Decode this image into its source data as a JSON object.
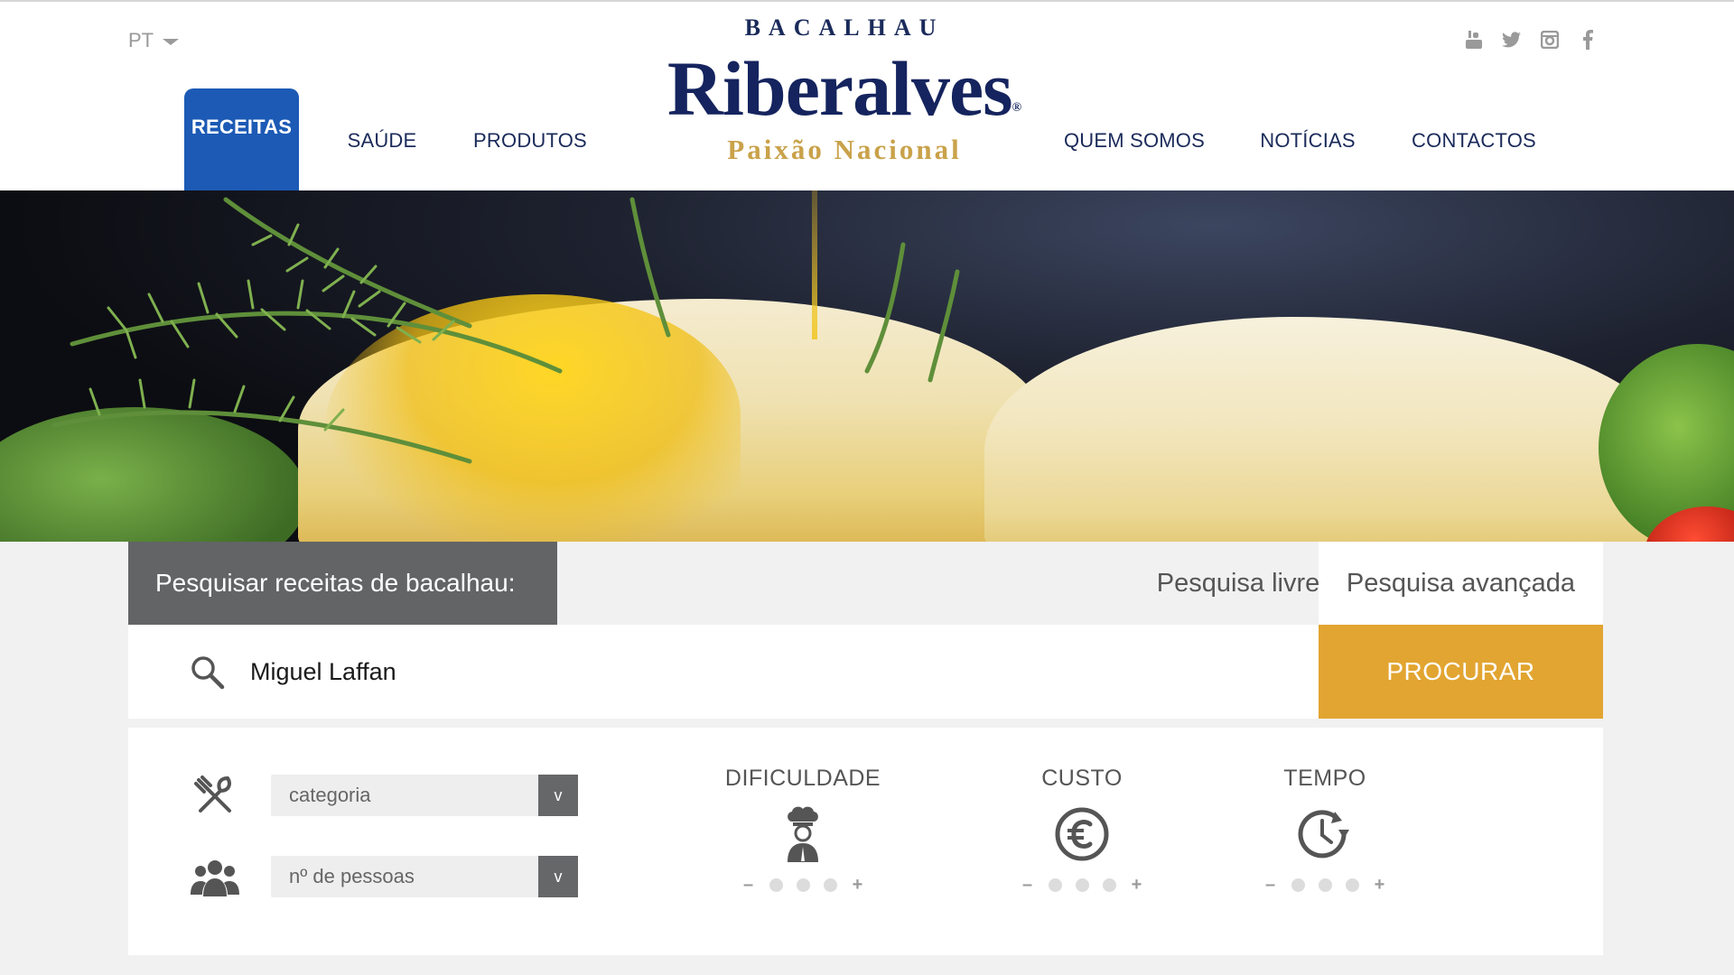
{
  "header": {
    "language": "PT",
    "nav_left": [
      {
        "label": "RECEITAS",
        "active": true
      },
      {
        "label": "SAÚDE"
      },
      {
        "label": "PRODUTOS"
      }
    ],
    "nav_right": [
      {
        "label": "QUEM SOMOS"
      },
      {
        "label": "NOTÍCIAS"
      },
      {
        "label": "CONTACTOS"
      }
    ],
    "logo": {
      "top": "BACALHAU",
      "brand": "Riberalves",
      "registered": "®",
      "tagline": "Paixão Nacional"
    },
    "social_icons": [
      "youtube-icon",
      "twitter-icon",
      "instagram-icon",
      "facebook-icon"
    ]
  },
  "search": {
    "title": "Pesquisar receitas de bacalhau:",
    "tab_free": "Pesquisa livre",
    "tab_advanced": "Pesquisa avançada",
    "query": "Miguel Laffan",
    "button": "PROCURAR",
    "filters": {
      "category": {
        "value": "categoria",
        "arrow": "v"
      },
      "people": {
        "value": "nº de pessoas",
        "arrow": "v"
      }
    },
    "meters": [
      {
        "label": "DIFICULDADE",
        "icon": "chef-icon",
        "minus": "–",
        "plus": "+",
        "level": 0
      },
      {
        "label": "CUSTO",
        "icon": "euro-icon",
        "minus": "–",
        "plus": "+",
        "level": 0
      },
      {
        "label": "TEMPO",
        "icon": "clock-icon",
        "minus": "–",
        "plus": "+",
        "level": 0
      }
    ]
  },
  "colors": {
    "brand_blue": "#15245e",
    "active_tab": "#1c5ab5",
    "gold": "#c9a24a",
    "button": "#e2a531",
    "dark_panel": "#626466"
  }
}
